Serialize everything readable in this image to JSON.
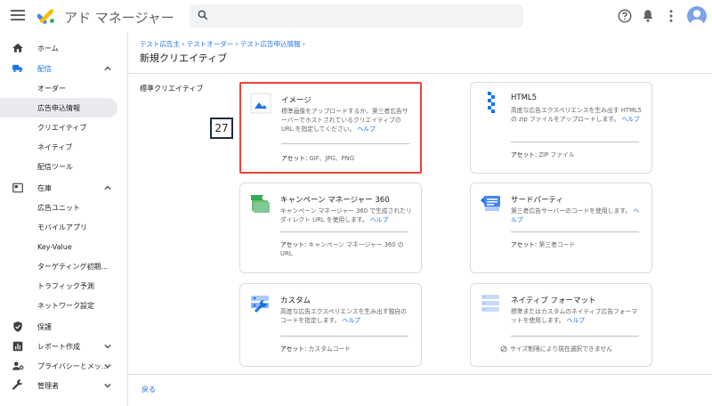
{
  "app": {
    "title": "アド マネージャー"
  },
  "topbar": {
    "search_placeholder": ""
  },
  "sidebar": {
    "items": [
      {
        "label": "ホーム"
      },
      {
        "label": "配信"
      },
      {
        "label": "オーダー"
      },
      {
        "label": "広告申込情報"
      },
      {
        "label": "クリエイティブ"
      },
      {
        "label": "ネイティブ"
      },
      {
        "label": "配信ツール"
      },
      {
        "label": "在庫"
      },
      {
        "label": "広告ユニット"
      },
      {
        "label": "モバイルアプリ"
      },
      {
        "label": "Key-Value"
      },
      {
        "label": "ターゲティング初期..."
      },
      {
        "label": "トラフィック予測"
      },
      {
        "label": "ネットワーク設定"
      },
      {
        "label": "保護"
      },
      {
        "label": "レポート作成"
      },
      {
        "label": "プライバシーとメッ..."
      },
      {
        "label": "管理者"
      }
    ]
  },
  "breadcrumb": "テスト広告主 › テストオーダー › テスト広告申込情報 ›",
  "page_title": "新規クリエイティブ",
  "section_label": "標準クリエイティブ",
  "badge": "27",
  "cards": [
    {
      "title": "イメージ",
      "desc": "標準画像をアップロードするか、第三者広告サーバーでホストされているクリエイティブの URL を指定してください。",
      "help": "ヘルプ",
      "asset_label": "アセット:",
      "asset_value": " GIF、JPG、PNG",
      "icon": "image-icon"
    },
    {
      "title": "HTML5",
      "desc": "高度な広告エクスペリエンスを生み出す HTML5 の zip ファイルをアップロードします。",
      "help": "ヘルプ",
      "asset_label": "アセット:",
      "asset_value": " ZIP ファイル",
      "icon": "html5-icon"
    },
    {
      "title": "キャンペーン マネージャー 360",
      "desc": "キャンペーン マネージャー 360 で生成されたリダイレクト URL を使用します。",
      "help": "ヘルプ",
      "asset_label": "アセット:",
      "asset_value": " キャンペーン マネージャー 360 の URL",
      "icon": "campaign-manager-icon"
    },
    {
      "title": "サードパーティ",
      "desc": "第三者広告サーバーのコードを使用します。",
      "help": "ヘルプ",
      "asset_label": "アセット:",
      "asset_value": " 第三者コード",
      "icon": "third-party-icon"
    },
    {
      "title": "カスタム",
      "desc": "高度な広告エクスペリエンスを生み出す独自のコードを指定します。",
      "help": "ヘルプ",
      "asset_label": "アセット:",
      "asset_value": " カスタムコード",
      "icon": "custom-icon"
    },
    {
      "title": "ネイティブ フォーマット",
      "desc": "標準またはカスタムのネイティブ広告フォーマットを使用します。",
      "help": "ヘルプ",
      "disabled_note": "サイズ制限により現在選択できません",
      "icon": "native-format-icon"
    }
  ],
  "back_label": "戻る"
}
